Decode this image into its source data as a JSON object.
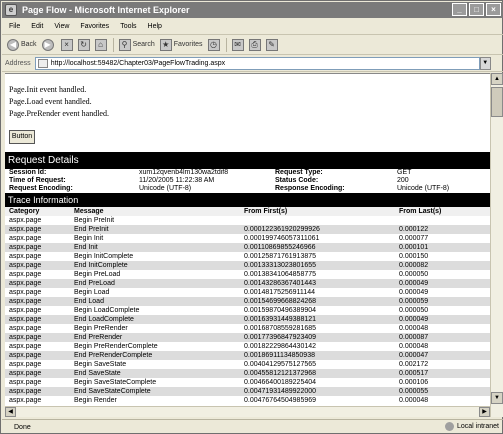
{
  "window": {
    "title": "Page Flow - Microsoft Internet Explorer"
  },
  "menu": [
    "File",
    "Edit",
    "View",
    "Favorites",
    "Tools",
    "Help"
  ],
  "toolbar": {
    "back": "Back",
    "search": "Search",
    "favorites": "Favorites"
  },
  "address": {
    "label": "Address",
    "url": "http://localhost:59482/Chapter03/PageFlowTrading.aspx"
  },
  "events": [
    "Page.Init event handled.",
    "Page.Load event handled.",
    "Page.PreRender event handled."
  ],
  "button": {
    "label": "Button"
  },
  "request_details": {
    "title": "Request Details",
    "left": [
      {
        "label": "Session Id:",
        "value": "xum12qvenb4lm130wa2tdif8"
      },
      {
        "label": "Time of Request:",
        "value": "11/20/2005 11:22:38 AM"
      },
      {
        "label": "Request Encoding:",
        "value": "Unicode (UTF-8)"
      }
    ],
    "right": [
      {
        "label": "Request Type:",
        "value": "GET"
      },
      {
        "label": "Status Code:",
        "value": "200"
      },
      {
        "label": "Response Encoding:",
        "value": "Unicode (UTF-8)"
      }
    ]
  },
  "trace": {
    "title": "Trace Information",
    "headers": [
      "Category",
      "Message",
      "From First(s)",
      "From Last(s)"
    ],
    "rows": [
      [
        "aspx.page",
        "Begin PreInit",
        "",
        ""
      ],
      [
        "aspx.page",
        "End PreInit",
        "0.000122361920299926",
        "0.000122"
      ],
      [
        "aspx.page",
        "Begin Init",
        "0.000199746057311061",
        "0.000077"
      ],
      [
        "aspx.page",
        "End Init",
        "0.00110869855246966",
        "0.000101"
      ],
      [
        "aspx.page",
        "Begin InitComplete",
        "0.00125871761913875",
        "0.000150"
      ],
      [
        "aspx.page",
        "End InitComplete",
        "0.00133313023801655",
        "0.000082"
      ],
      [
        "aspx.page",
        "Begin PreLoad",
        "0.00138341064858775",
        "0.000050"
      ],
      [
        "aspx.page",
        "End PreLoad",
        "0.00143286367401443",
        "0.000049"
      ],
      [
        "aspx.page",
        "Begin Load",
        "0.00148175256911144",
        "0.000049"
      ],
      [
        "aspx.page",
        "End Load",
        "0.00154699668824268",
        "0.000059"
      ],
      [
        "aspx.page",
        "Begin LoadComplete",
        "0.00159870496389904",
        "0.000050"
      ],
      [
        "aspx.page",
        "End LoadComplete",
        "0.00163931449388121",
        "0.000049"
      ],
      [
        "aspx.page",
        "Begin PreRender",
        "0.00168708559281685",
        "0.000048"
      ],
      [
        "aspx.page",
        "End PreRender",
        "0.00177396847923409",
        "0.000087"
      ],
      [
        "aspx.page",
        "Begin PreRenderComplete",
        "0.00182229864430142",
        "0.000048"
      ],
      [
        "aspx.page",
        "End PreRenderComplete",
        "0.00186911134850938",
        "0.000047"
      ],
      [
        "aspx.page",
        "Begin SaveState",
        "0.00404129575127565",
        "0.002172"
      ],
      [
        "aspx.page",
        "End SaveState",
        "0.00455812121372968",
        "0.000517"
      ],
      [
        "aspx.page",
        "Begin SaveStateComplete",
        "0.00466400189225404",
        "0.000106"
      ],
      [
        "aspx.page",
        "End SaveStateComplete",
        "0.00471931489922000",
        "0.000055"
      ],
      [
        "aspx.page",
        "Begin Render",
        "0.00476764504985969",
        "0.000048"
      ]
    ]
  },
  "status": {
    "text": "Done",
    "zone": "Local intranet"
  },
  "colors": {
    "section_header_bg": "#000000",
    "alt_row_bg": "#dcdcdc",
    "title_bar": "#7a7a7a"
  }
}
